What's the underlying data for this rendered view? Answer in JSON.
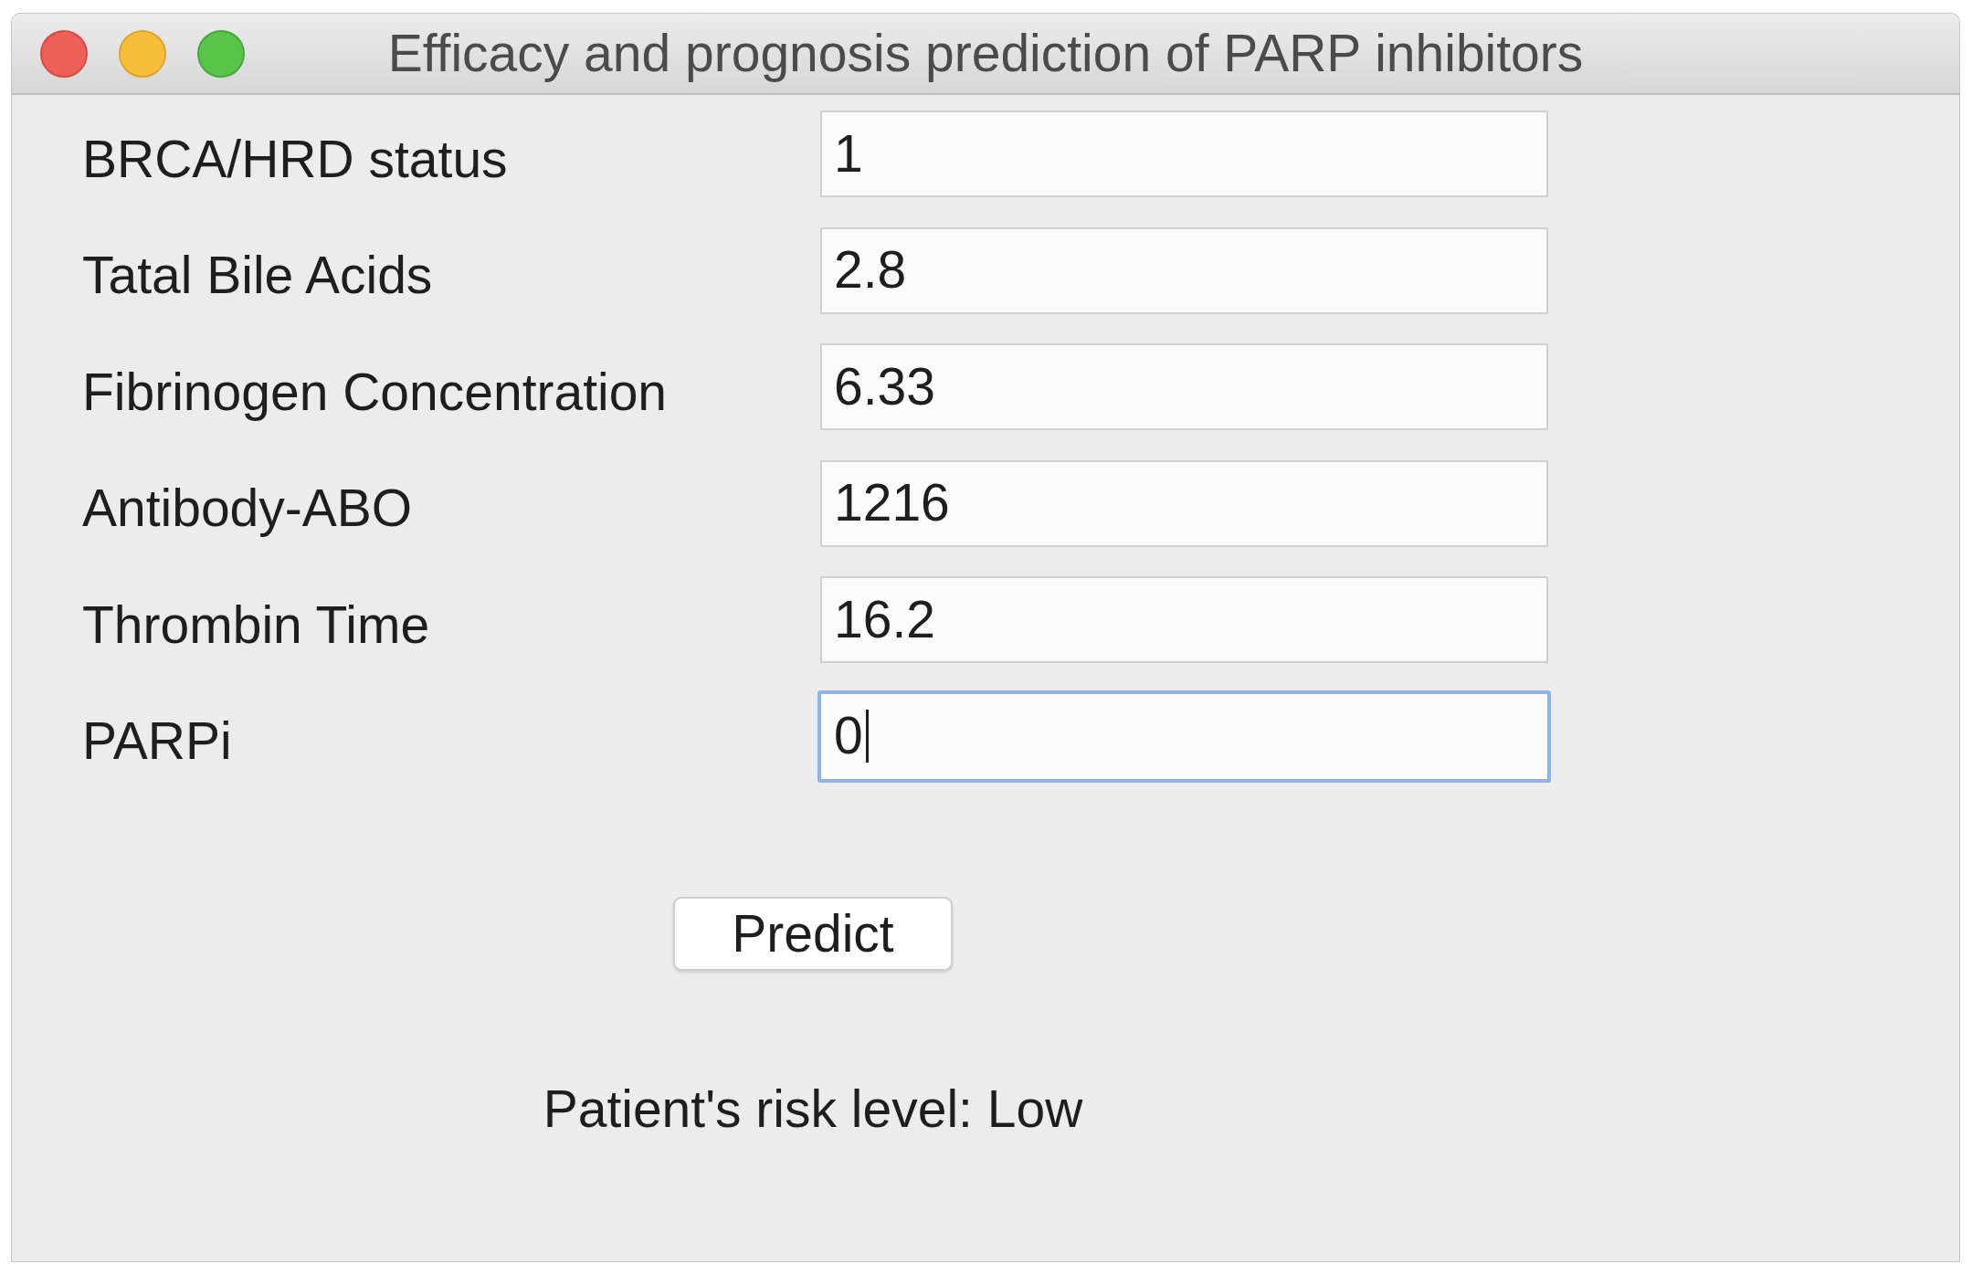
{
  "window": {
    "title": "Efficacy and prognosis prediction of PARP inhibitors"
  },
  "fields": [
    {
      "label": "BRCA/HRD status",
      "value": "1",
      "focused": false
    },
    {
      "label": "Tatal Bile Acids",
      "value": "2.8",
      "focused": false
    },
    {
      "label": "Fibrinogen Concentration",
      "value": "6.33",
      "focused": false
    },
    {
      "label": "Antibody-ABO",
      "value": "1216",
      "focused": false
    },
    {
      "label": "Thrombin Time",
      "value": "16.2",
      "focused": false
    },
    {
      "label": "PARPi",
      "value": "0",
      "focused": true
    }
  ],
  "predict_button": {
    "label": "Predict"
  },
  "result": {
    "text": "Patient's risk level: Low"
  }
}
